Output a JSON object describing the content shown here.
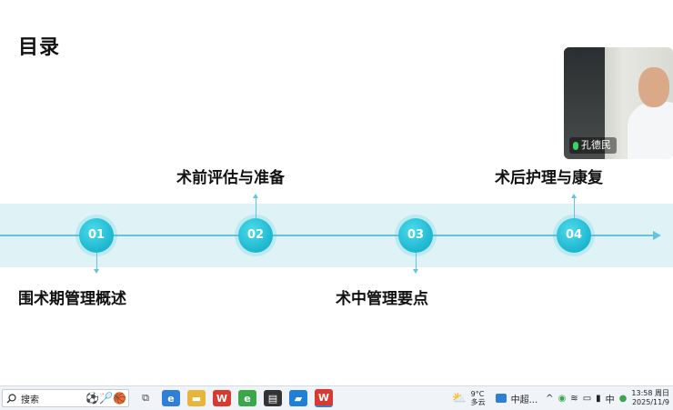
{
  "slide": {
    "title": "目录",
    "steps": [
      {
        "num": "01",
        "label": "围术期管理概述"
      },
      {
        "num": "02",
        "label": "术前评估与准备"
      },
      {
        "num": "03",
        "label": "术中管理要点"
      },
      {
        "num": "04",
        "label": "术后护理与康复"
      }
    ]
  },
  "video_call": {
    "speaker_name": "孔德民"
  },
  "taskbar": {
    "search_placeholder": "搜索",
    "weather_temp": "9°C",
    "weather_desc": "多云",
    "app_label": "中超...",
    "ime": "中",
    "time": "13:58 周日",
    "date": "2025/11/9"
  },
  "colors": {
    "accent": "#1cb6cf",
    "band": "#dff3f6",
    "line": "#62c4dd"
  }
}
